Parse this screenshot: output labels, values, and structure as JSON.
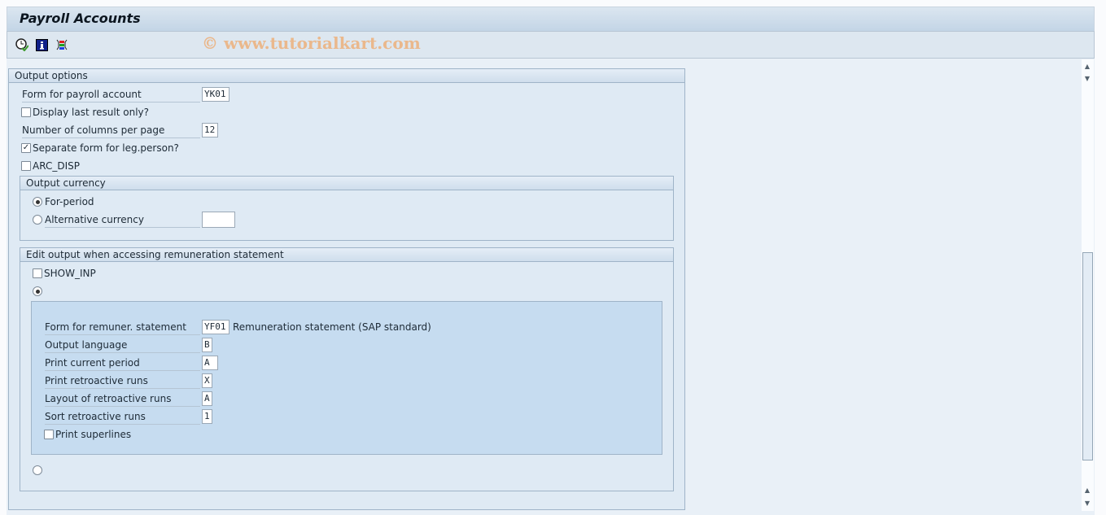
{
  "window": {
    "title": "Payroll Accounts"
  },
  "toolbar": {
    "icons": [
      "execute-icon",
      "info-icon",
      "variant-icon"
    ],
    "watermark": "© www.tutorialkart.com"
  },
  "output_options": {
    "header": "Output options",
    "form_label": "Form for payroll account",
    "form_value": "YK01",
    "last_result_label": "Display last result only?",
    "last_result_checked": false,
    "columns_label": "Number of columns per page",
    "columns_value": "12",
    "separate_label": "Separate form for leg.person?",
    "separate_checked": true,
    "arc_label": "ARC_DISP",
    "arc_checked": false
  },
  "output_currency": {
    "header": "Output currency",
    "for_period": "For-period",
    "for_period_selected": true,
    "alternative": "Alternative currency",
    "alternative_value": ""
  },
  "edit_output": {
    "header": "Edit output when accessing remuneration statement",
    "show_inp": "SHOW_INP",
    "show_inp_checked": false,
    "rows": [
      {
        "label": "Form for remuner. statement",
        "value": "YF01",
        "desc": "Remuneration statement (SAP standard)"
      },
      {
        "label": "Output language",
        "value": "B"
      },
      {
        "label": "Print current period",
        "value": "A"
      },
      {
        "label": "Print retroactive runs",
        "value": "X"
      },
      {
        "label": "Layout of retroactive runs",
        "value": "A"
      },
      {
        "label": "Sort retroactive runs",
        "value": "1"
      }
    ],
    "superlines": "Print superlines",
    "superlines_checked": false
  },
  "colors": {
    "accent": "#c6dcf0",
    "watermark": "#eab88c"
  }
}
